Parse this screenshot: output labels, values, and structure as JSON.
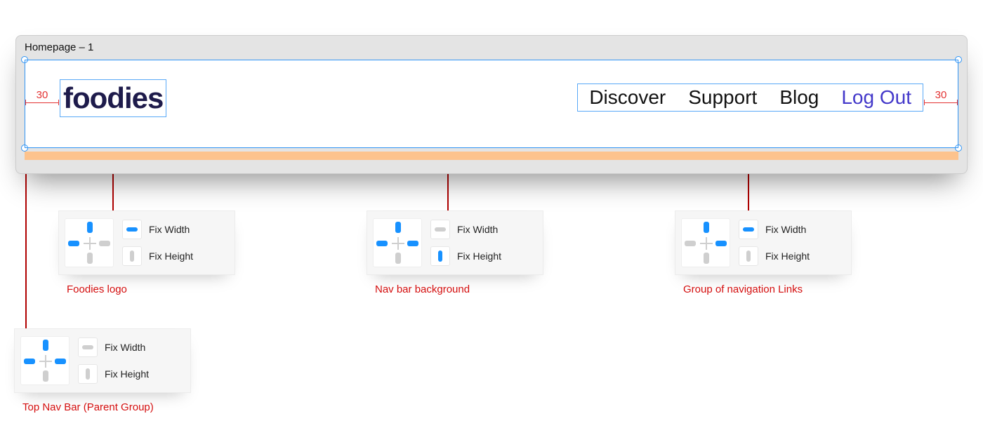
{
  "window": {
    "title": "Homepage – 1"
  },
  "artboard": {
    "margin_left": "30",
    "margin_right": "30",
    "logo": "foodies",
    "nav": {
      "items": [
        "Discover",
        "Support",
        "Blog",
        "Log Out"
      ],
      "accent_index": 3
    }
  },
  "panels": {
    "logo": {
      "pins": {
        "top": true,
        "left": true,
        "right": false,
        "bottom": false
      },
      "fix_width": {
        "label": "Fix Width",
        "on": true
      },
      "fix_height": {
        "label": "Fix Height",
        "on": false
      },
      "caption": "Foodies logo"
    },
    "background": {
      "pins": {
        "top": true,
        "left": true,
        "right": true,
        "bottom": false
      },
      "fix_width": {
        "label": "Fix Width",
        "on": false
      },
      "fix_height": {
        "label": "Fix Height",
        "on": true
      },
      "caption": "Nav bar background"
    },
    "links": {
      "pins": {
        "top": true,
        "left": false,
        "right": true,
        "bottom": false
      },
      "fix_width": {
        "label": "Fix Width",
        "on": true
      },
      "fix_height": {
        "label": "Fix Height",
        "on": false
      },
      "caption": "Group of navigation Links"
    },
    "parent": {
      "pins": {
        "top": true,
        "left": true,
        "right": true,
        "bottom": false
      },
      "fix_width": {
        "label": "Fix Width",
        "on": false
      },
      "fix_height": {
        "label": "Fix Height",
        "on": false
      },
      "caption": "Top Nav Bar (Parent Group)"
    }
  }
}
